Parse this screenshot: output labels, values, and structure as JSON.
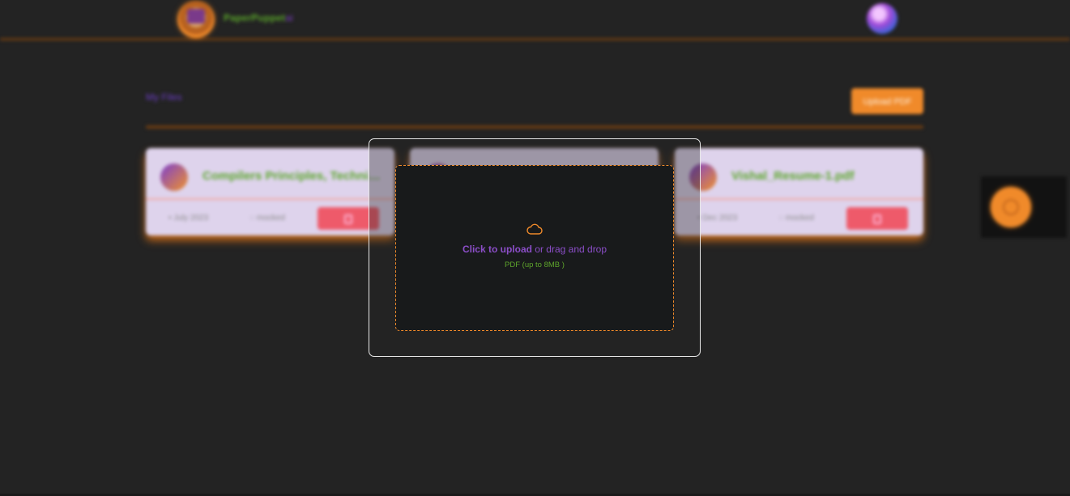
{
  "navbar": {
    "brand_main": "PaperPuppet",
    "brand_suffix": "ai"
  },
  "page": {
    "title": "My Files",
    "upload_button": "Upload PDF"
  },
  "files": [
    {
      "name": "Compilers Principles, Techniques",
      "date": "July 2023",
      "status": "mocked"
    },
    {
      "name": "",
      "date": "",
      "status": ""
    },
    {
      "name": "Vishal_Resume-1.pdf",
      "date": "Dec 2023",
      "status": "mocked"
    }
  ],
  "upload_modal": {
    "action_text": "Click to upload",
    "secondary_text": " or drag and drop",
    "hint": "PDF (up to 8MB )"
  },
  "colors": {
    "accent": "#f08a2a",
    "purple": "#8b4ec8",
    "green": "#5ea52c",
    "background": "#232323"
  },
  "icons": [
    "cloud-upload-icon",
    "calendar-icon",
    "chat-icon",
    "trash-icon",
    "chat-bot-icon",
    "user-avatar"
  ]
}
